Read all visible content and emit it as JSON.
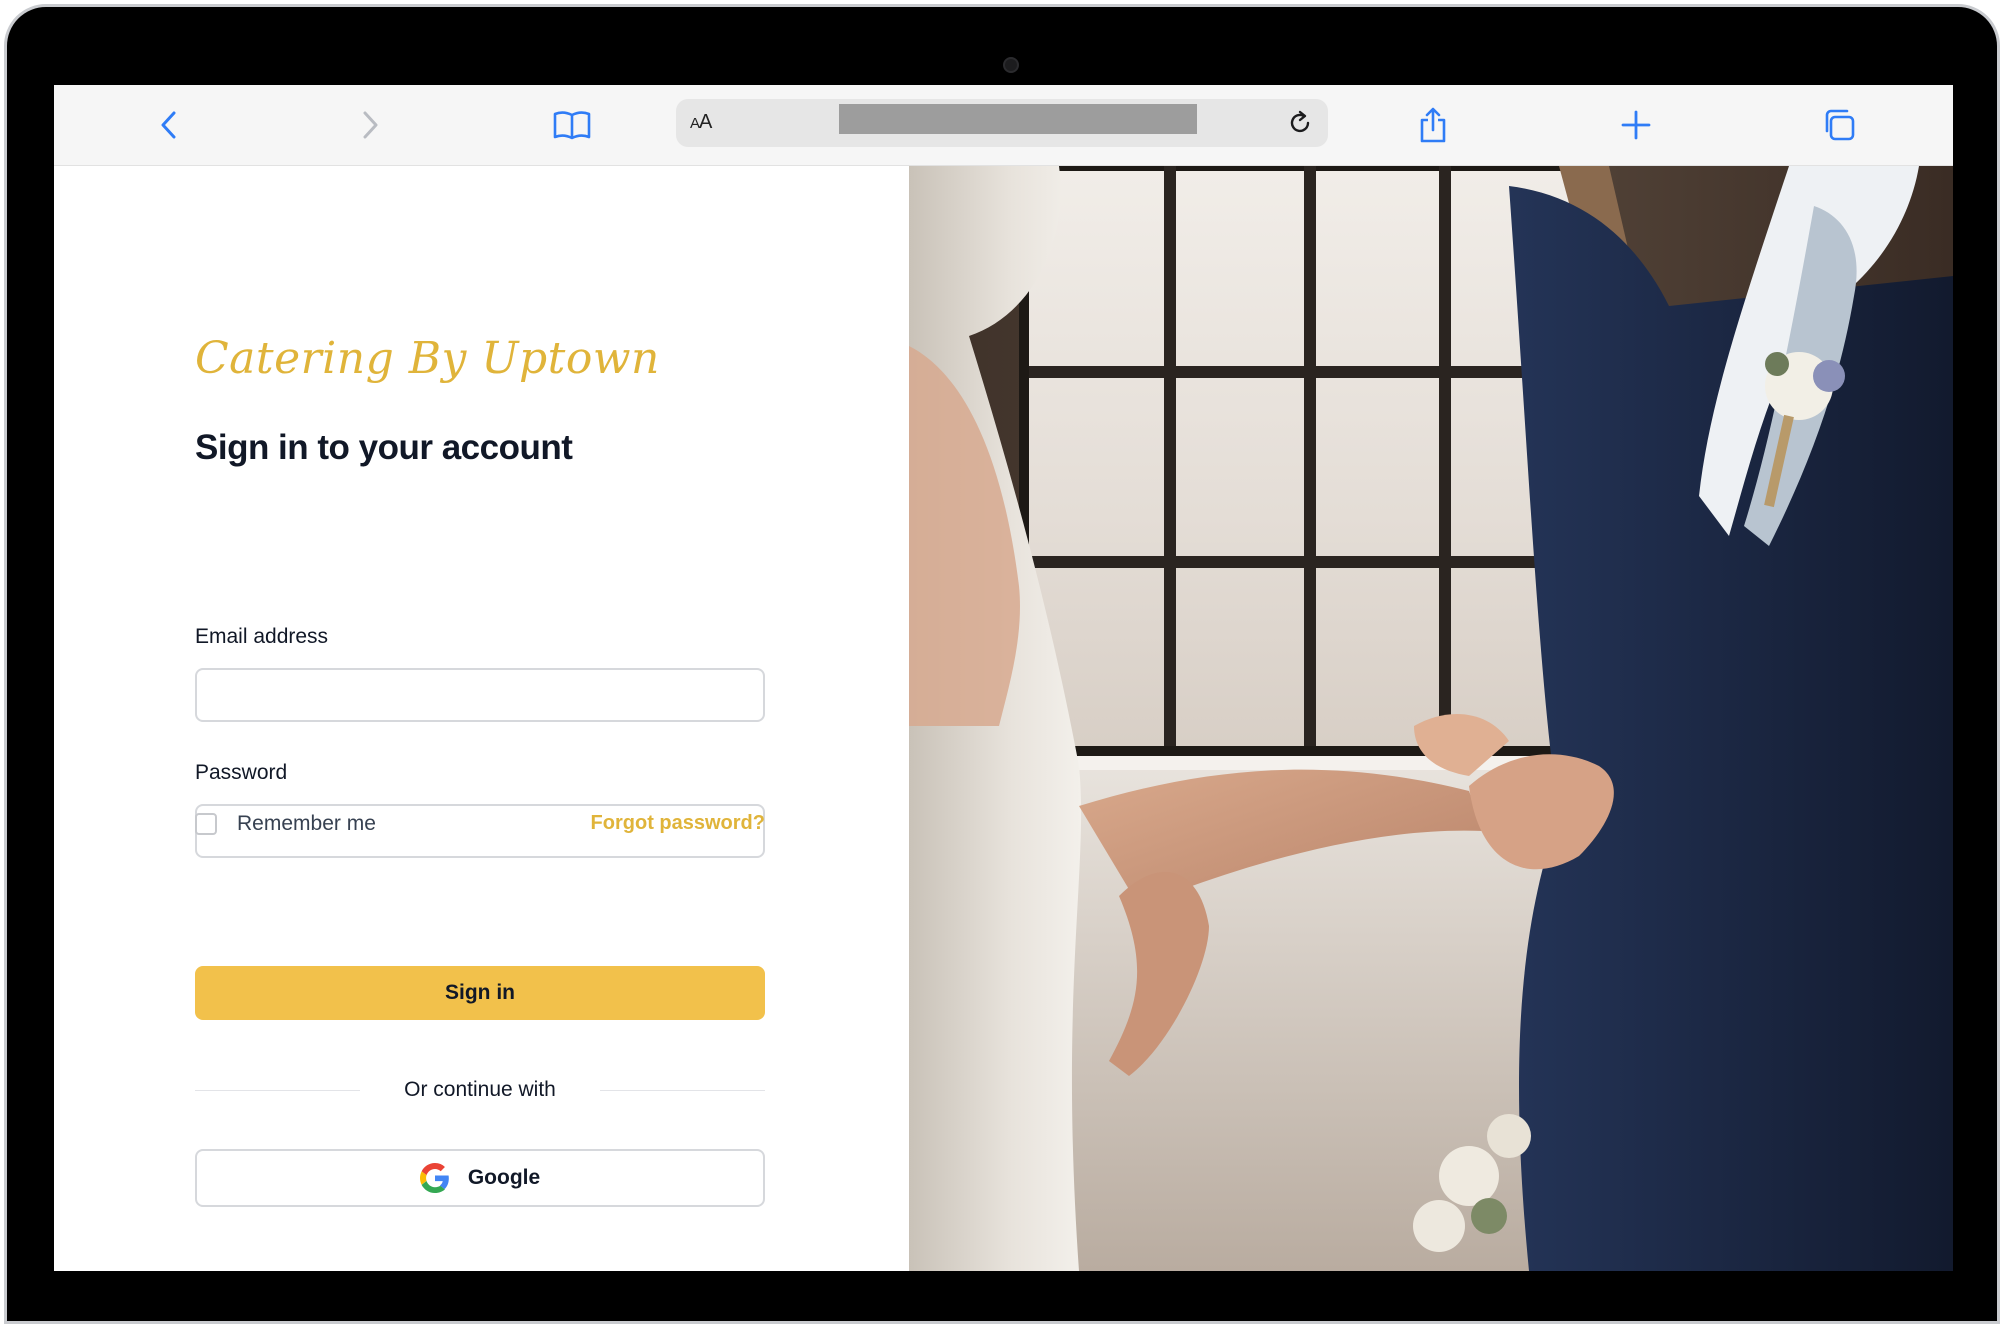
{
  "browser": {
    "text_size_label_big": "A",
    "text_size_label_small": "A",
    "icons": {
      "back": "chevron-left-icon",
      "forward": "chevron-right-icon",
      "bookmarks": "book-icon",
      "reload": "reload-icon",
      "share": "share-icon",
      "new_tab": "plus-icon",
      "tabs": "tabs-icon"
    }
  },
  "brand": {
    "logo_text": "Catering By Uptown",
    "accent_color": "#e0b43a",
    "button_color": "#f2c14b"
  },
  "form": {
    "title": "Sign in to your account",
    "email_label": "Email address",
    "email_value": "",
    "password_label": "Password",
    "password_value": "",
    "remember_label": "Remember me",
    "remember_checked": false,
    "forgot_label": "Forgot password?",
    "submit_label": "Sign in",
    "divider_label": "Or continue with",
    "google_label": "Google"
  },
  "hero_image": {
    "subject": "wedding ring exchange photo"
  }
}
